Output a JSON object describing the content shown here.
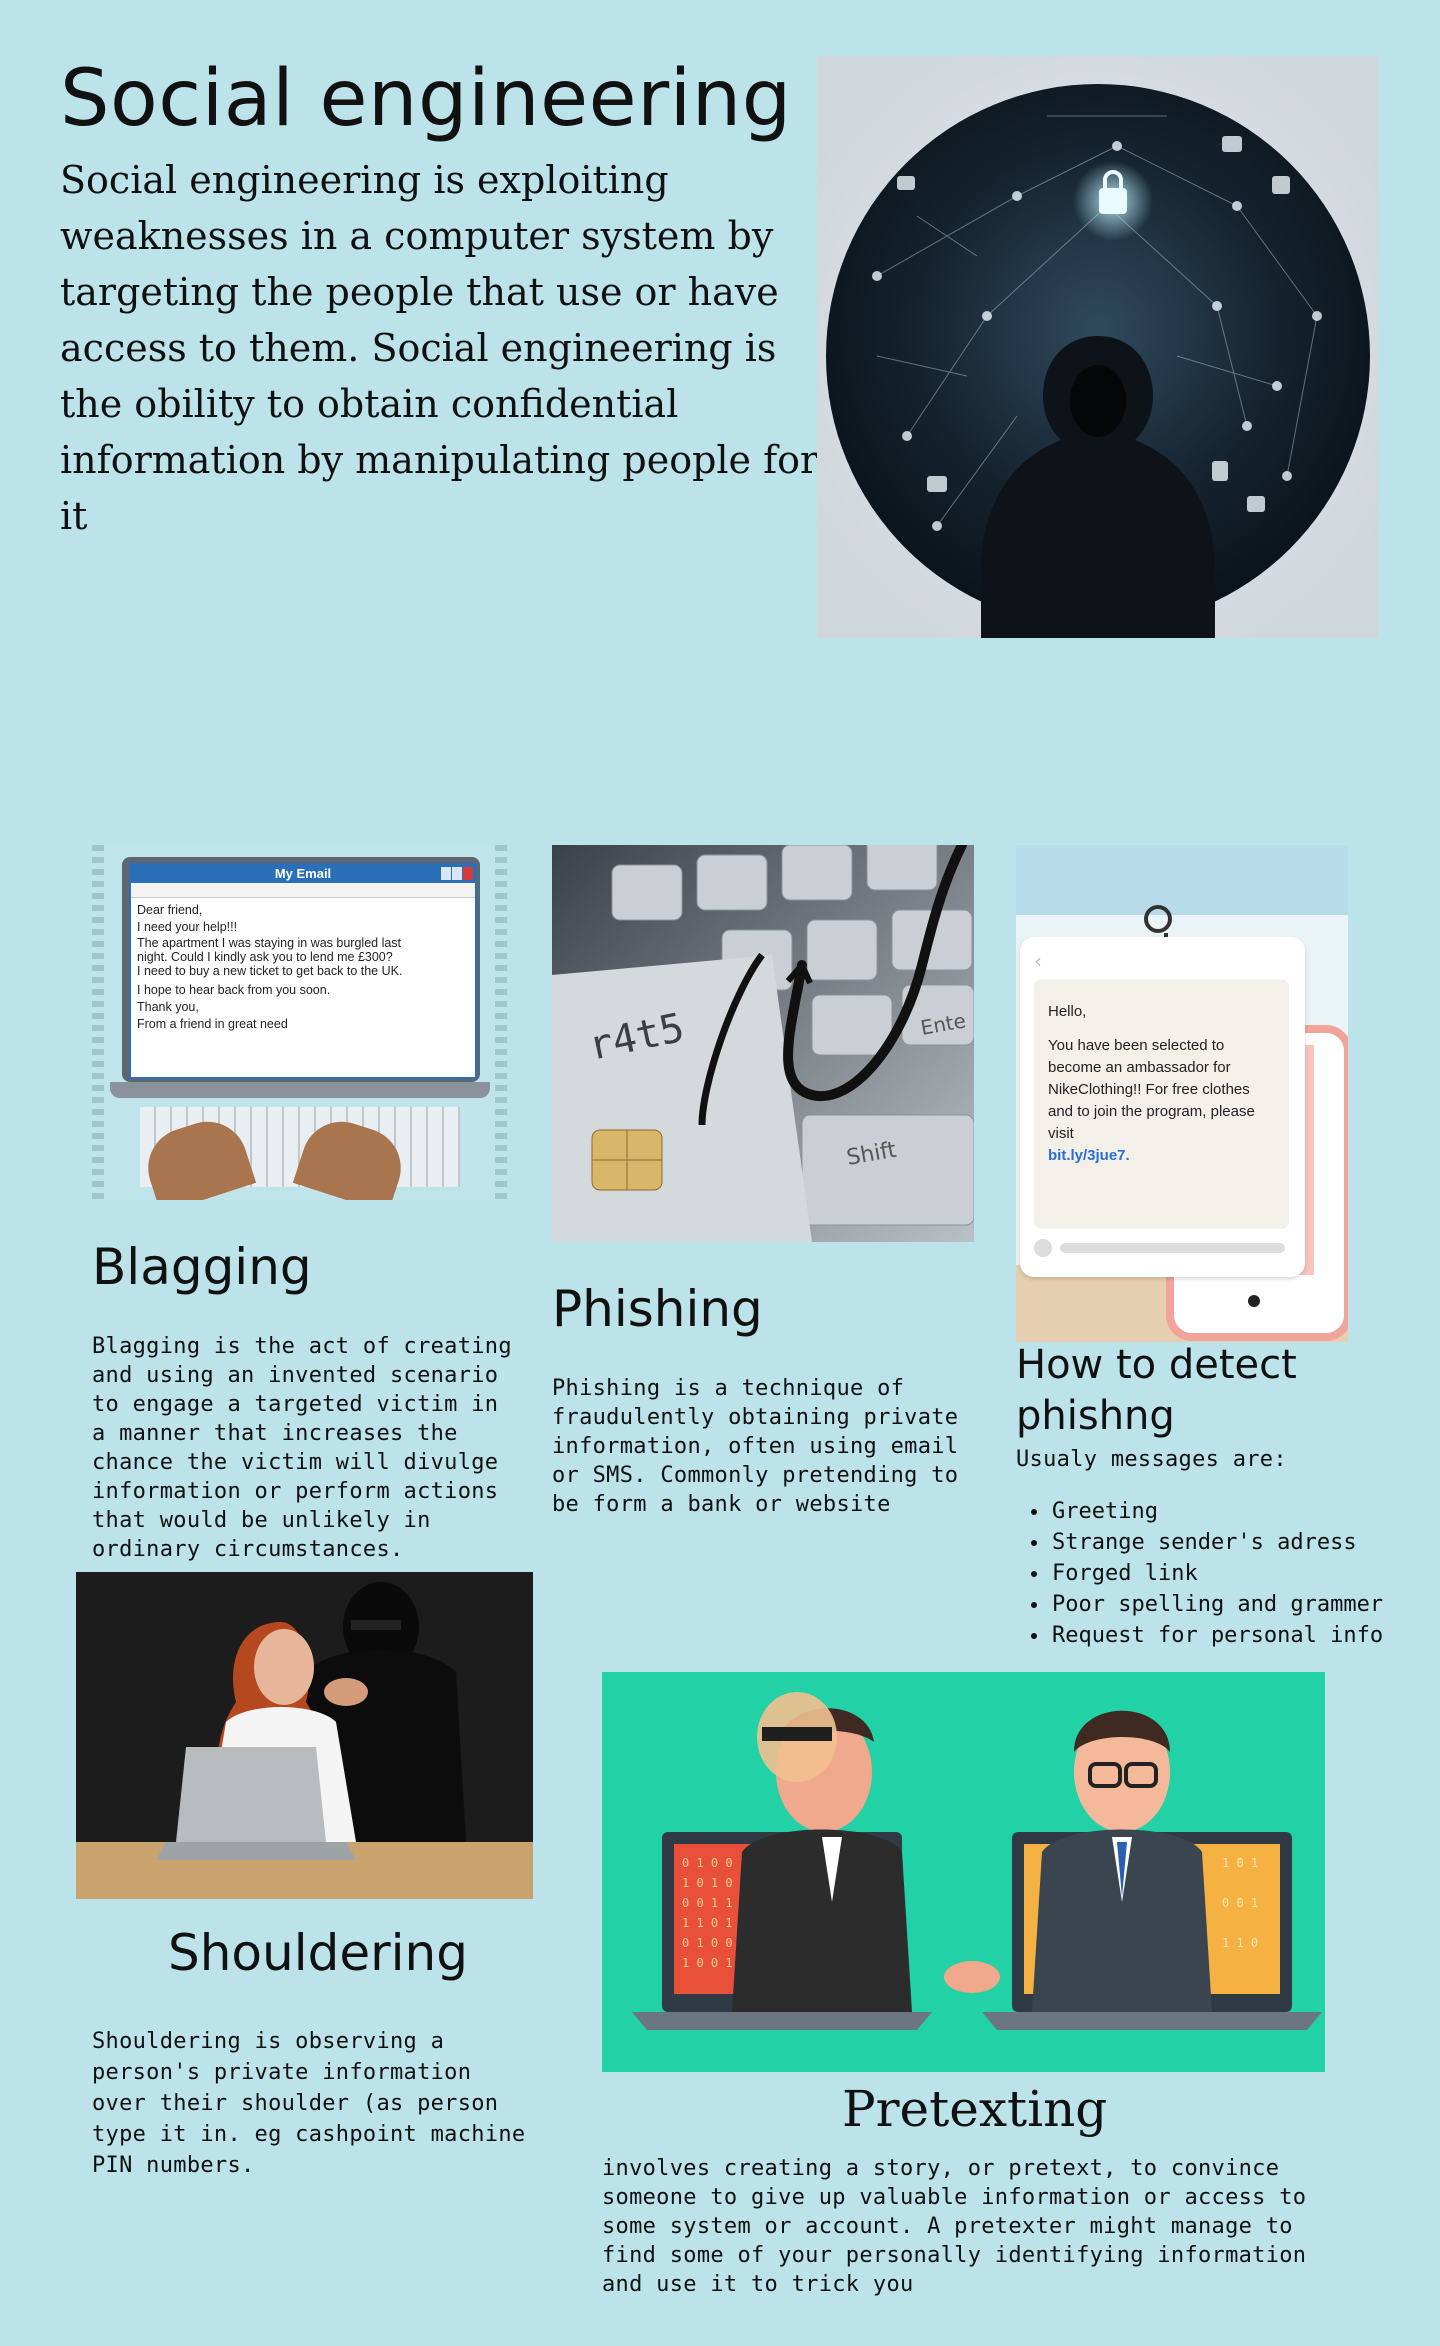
{
  "header": {
    "title": "Social engineering",
    "intro": "Social engineering is exploiting weaknesses in a computer system by targeting the people that use or have access to them. Social engineering is the obility to obtain confidential information by manipulating people for it"
  },
  "blagging": {
    "title": "Blagging",
    "text": "Blagging is the act of creating and using an invented scenario to engage a targeted victim in a manner that increases the chance the victim will divulge information or perform actions that would be unlikely in ordinary circumstances.",
    "email": {
      "window_title": "My Email",
      "lines": [
        "Dear friend,",
        "I need your help!!!",
        "The apartment I was staying in was burgled last",
        "night. Could I kindly ask you to lend me £300?",
        "I need to buy a new ticket to get back to the UK.",
        "I hope to hear back from you soon.",
        "Thank you,",
        "From a friend in great need"
      ]
    }
  },
  "phishing": {
    "title": "Phishing",
    "text": "Phishing is a technique of fraudulently obtaining private information, often using email or SMS. Commonly pretending to be form  a bank or website",
    "key_labels": {
      "shift": "Shift",
      "enter": "Ente"
    }
  },
  "detect": {
    "title": "How to detect phishng",
    "subtitle": "Usualy messages are:",
    "items": [
      "Greeting",
      "Strange sender's adress",
      "Forged link",
      "Poor spelling and grammer",
      "Request for personal info"
    ],
    "sms": {
      "greeting": "Hello,",
      "body": "You have been selected to become an ambassador for NikeClothing!! For free clothes and to join the program, please visit",
      "link": "bit.ly/3jue7."
    }
  },
  "shouldering": {
    "title": "Shouldering",
    "text": "Shouldering is observing a person's private information over their shoulder (as person type it in. eg cashpoint machine PIN numbers."
  },
  "pretexting": {
    "title": "Pretexting",
    "text": "involves creating a story, or pretext, to convince someone to give up valuable information or access to some system or account. A pretexter might manage to find some of your personally identifying information and use it to trick you"
  }
}
